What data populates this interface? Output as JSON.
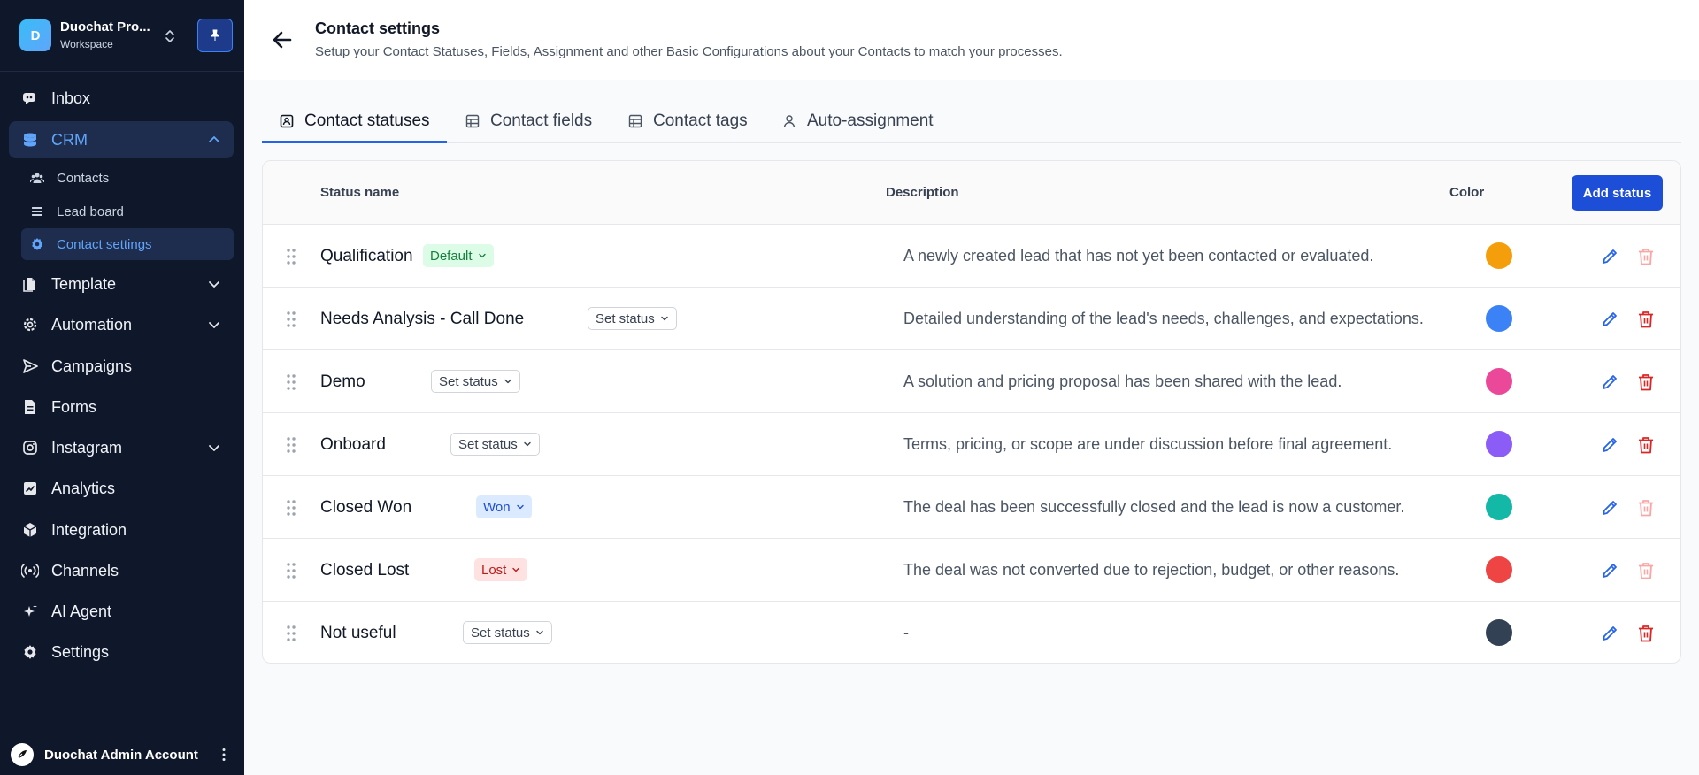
{
  "workspace": {
    "initial": "D",
    "name": "Duochat Pro...",
    "subtitle": "Workspace"
  },
  "nav": {
    "inbox": "Inbox",
    "crm": "CRM",
    "crm_sub": {
      "contacts": "Contacts",
      "lead_board": "Lead board",
      "contact_settings": "Contact settings"
    },
    "template": "Template",
    "automation": "Automation",
    "campaigns": "Campaigns",
    "forms": "Forms",
    "instagram": "Instagram",
    "analytics": "Analytics",
    "integration": "Integration",
    "channels": "Channels",
    "ai_agent": "AI Agent",
    "settings": "Settings"
  },
  "account": {
    "name": "Duochat Admin Account"
  },
  "header": {
    "title": "Contact settings",
    "subtitle": "Setup your Contact Statuses, Fields, Assignment and other Basic Configurations about your Contacts to match your processes."
  },
  "tabs": {
    "statuses": "Contact statuses",
    "fields": "Contact fields",
    "tags": "Contact tags",
    "assignment": "Auto-assignment",
    "active": "Contact statuses"
  },
  "table": {
    "columns": {
      "name": "Status name",
      "description": "Description",
      "color": "Color"
    },
    "add_button": "Add status",
    "rows": [
      {
        "name": "Qualification",
        "badge": "Default",
        "badge_type": "default",
        "description": "A newly created lead that has not yet been contacted or evaluated.",
        "color": "#f59e0b",
        "deletable": false
      },
      {
        "name": "Needs Analysis - Call Done",
        "badge": "Set status",
        "badge_type": "set",
        "description": "Detailed understanding of the lead's needs, challenges, and expectations.",
        "color": "#3b82f6",
        "deletable": true
      },
      {
        "name": "Demo",
        "badge": "Set status",
        "badge_type": "set",
        "description": "A solution and pricing proposal has been shared with the lead.",
        "color": "#ec4899",
        "deletable": true
      },
      {
        "name": "Onboard",
        "badge": "Set status",
        "badge_type": "set",
        "description": "Terms, pricing, or scope are under discussion before final agreement.",
        "color": "#8b5cf6",
        "deletable": true
      },
      {
        "name": "Closed Won",
        "badge": "Won",
        "badge_type": "won",
        "description": "The deal has been successfully closed and the lead is now a customer.",
        "color": "#14b8a6",
        "deletable": false
      },
      {
        "name": "Closed Lost",
        "badge": "Lost",
        "badge_type": "lost",
        "description": "The deal was not converted due to rejection, budget, or other reasons.",
        "color": "#ef4444",
        "deletable": false
      },
      {
        "name": "Not useful",
        "badge": "Set status",
        "badge_type": "set",
        "description": "-",
        "color": "#334155",
        "deletable": true
      }
    ]
  },
  "icons": {
    "inbox": "inbox-icon",
    "crm": "database-icon",
    "contacts": "users-icon",
    "lead_board": "list-icon",
    "contact_settings": "gear-icon",
    "template": "file-icon",
    "automation": "cog-icon",
    "campaigns": "send-icon",
    "forms": "form-icon",
    "instagram": "instagram-icon",
    "analytics": "chart-icon",
    "integration": "cube-icon",
    "channels": "broadcast-icon",
    "ai_agent": "sparkle-icon",
    "settings": "gear-icon"
  },
  "colors": {
    "accent": "#2563eb",
    "sidebar_bg": "#0f172a",
    "active_nav_bg": "#1e2d4d",
    "delete_red": "#dc2626",
    "edit_blue": "#2563eb"
  }
}
